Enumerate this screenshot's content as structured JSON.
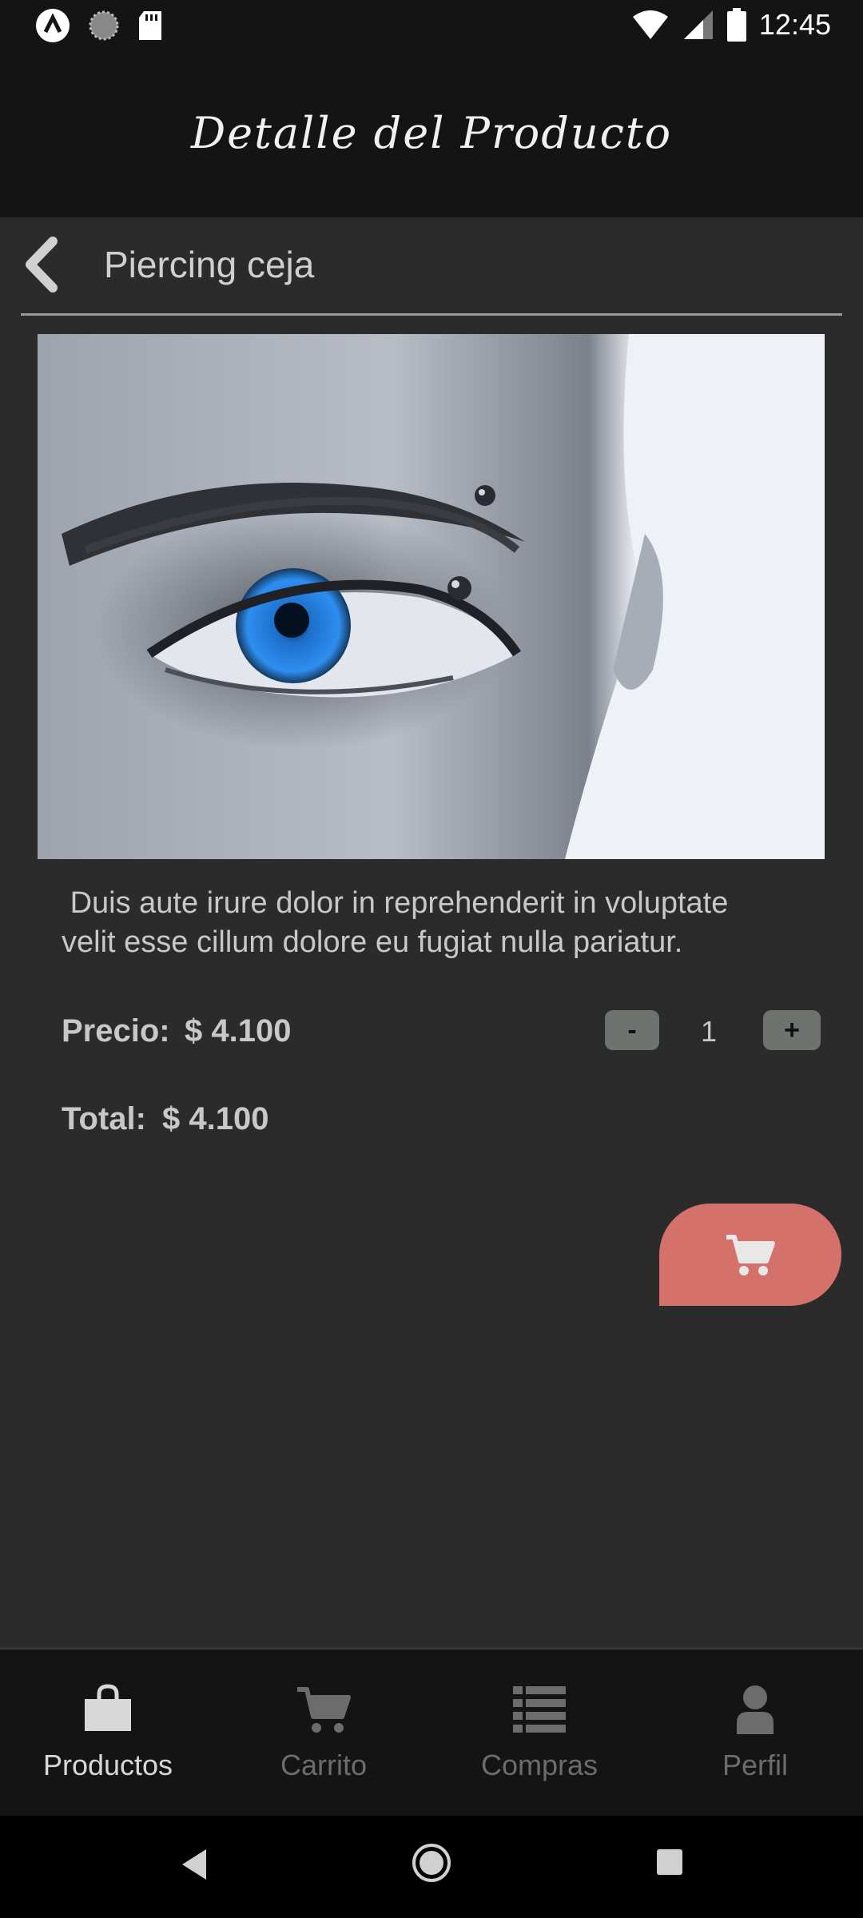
{
  "status_bar": {
    "time": "12:45",
    "left_icons": [
      "app-logo-icon",
      "loading-spinner-icon",
      "sd-card-icon"
    ],
    "right_icons": [
      "wifi-icon",
      "cell-signal-icon",
      "battery-icon"
    ]
  },
  "header": {
    "title": "Detalle del Producto"
  },
  "product": {
    "name": "Piercing ceja",
    "description": " Duis aute irure dolor in reprehenderit in voluptate\nvelit esse cillum dolore eu fugiat nulla pariatur.",
    "price_label": "Precio:",
    "price_value": "$ 4.100",
    "total_label": "Total:",
    "total_value": "$ 4.100",
    "quantity": "1",
    "minus_label": "-",
    "plus_label": "+"
  },
  "bottom_nav": {
    "items": [
      {
        "label": "Productos",
        "icon": "shopping-bag-icon",
        "active": true
      },
      {
        "label": "Carrito",
        "icon": "cart-icon",
        "active": false
      },
      {
        "label": "Compras",
        "icon": "list-icon",
        "active": false
      },
      {
        "label": "Perfil",
        "icon": "user-icon",
        "active": false
      }
    ]
  },
  "colors": {
    "background": "#2b2b2c",
    "header": "#141414",
    "fab": "#d4716b",
    "qty_button": "#6e7370"
  }
}
